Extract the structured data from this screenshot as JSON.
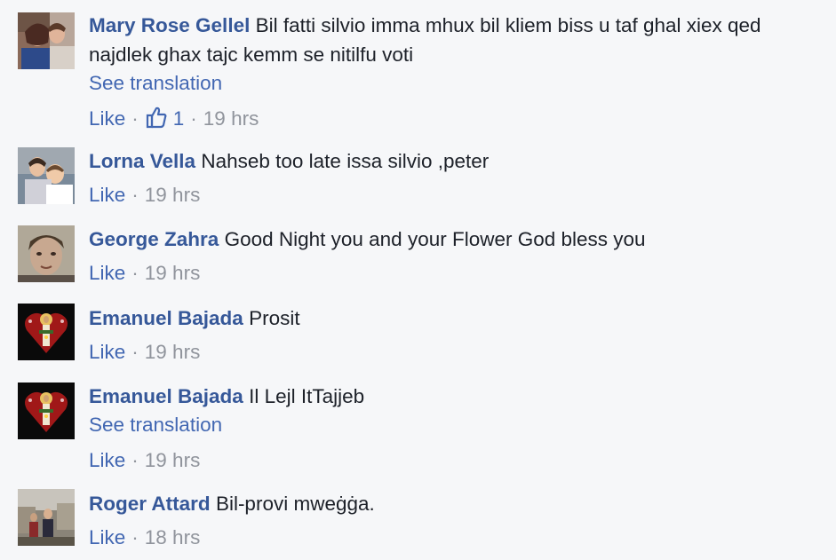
{
  "comments": [
    {
      "author": "Mary Rose Gellel",
      "text": "Bil fatti silvio imma mhux bil kliem biss u taf ghal xiex qed najdlek ghax tajc kemm se nitilfu voti",
      "see_translation": "See translation",
      "like_label": "Like",
      "reaction_count": "1",
      "time": "19 hrs",
      "avatar_icon": "couple-photo-avatar"
    },
    {
      "author": "Lorna Vella",
      "text": "Nahseb too late issa silvio ,peter",
      "like_label": "Like",
      "time": "19 hrs",
      "avatar_icon": "family-photo-avatar"
    },
    {
      "author": "George Zahra",
      "text": "Good Night you and your Flower God bless you",
      "like_label": "Like",
      "time": "19 hrs",
      "avatar_icon": "portrait-photo-avatar"
    },
    {
      "author": "Emanuel Bajada",
      "text": "Prosit",
      "like_label": "Like",
      "time": "19 hrs",
      "avatar_icon": "sacred-heart-avatar"
    },
    {
      "author": "Emanuel Bajada",
      "text": "Il Lejl ItTajjeb",
      "see_translation": "See translation",
      "like_label": "Like",
      "time": "19 hrs",
      "avatar_icon": "sacred-heart-avatar"
    },
    {
      "author": "Roger Attard",
      "text": "Bil-provi mweġġa.",
      "like_label": "Like",
      "time": "18 hrs",
      "avatar_icon": "outdoor-photo-avatar"
    }
  ],
  "colors": {
    "background": "#f6f7f9",
    "author": "#365899",
    "link": "#4267b2",
    "meta": "#90949c",
    "text": "#1d2129"
  }
}
